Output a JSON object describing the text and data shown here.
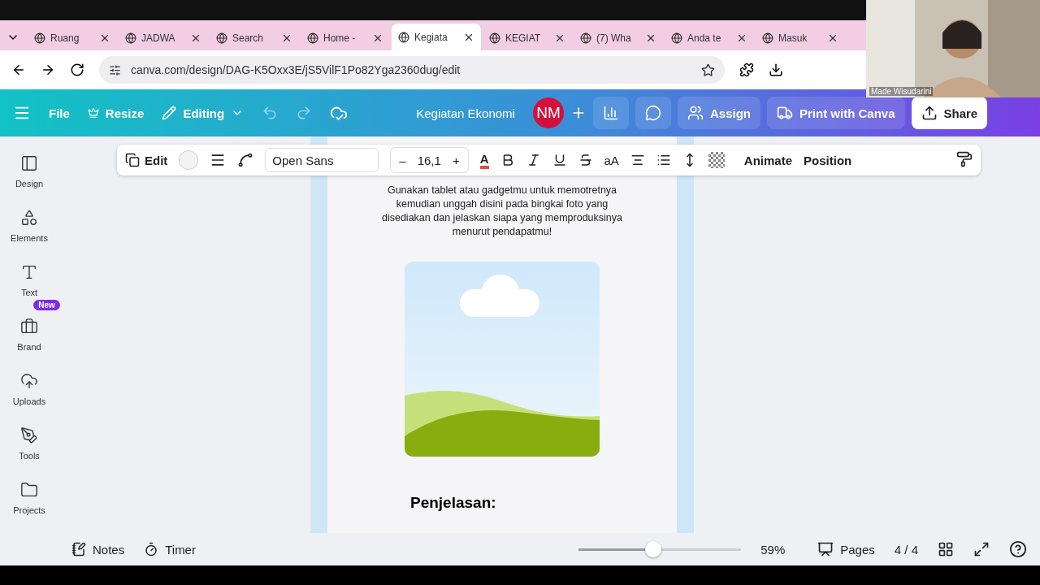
{
  "browser": {
    "tabs": [
      {
        "title": "Ruang",
        "selected": false
      },
      {
        "title": "JADWA",
        "selected": false
      },
      {
        "title": "Search",
        "selected": false
      },
      {
        "title": "Home -",
        "selected": false
      },
      {
        "title": "Kegiata",
        "selected": true
      },
      {
        "title": "KEGIAT",
        "selected": false
      },
      {
        "title": "(7) Wha",
        "selected": false
      },
      {
        "title": "Anda te",
        "selected": false
      },
      {
        "title": "Masuk",
        "selected": false
      }
    ],
    "url": "canva.com/design/DAG-K5Oxx3E/jS5VilF1Po82Yga2360dug/edit"
  },
  "video_overlay": {
    "kind": "picture",
    "name": "Made Wisudarini"
  },
  "header": {
    "menu": [
      "File",
      "Resize"
    ],
    "mode": "Editing",
    "design_title": "Kegiatan Ekonomi",
    "avatar": "NM",
    "buttons": [
      "Assign",
      "Print with Canva",
      "Share"
    ]
  },
  "toolbar": {
    "edit": "Edit",
    "font": "Open Sans",
    "minus": "–",
    "size": "16,1",
    "plus": "+",
    "text_color": "A",
    "text_buttons": [
      "aA"
    ],
    "animate": "Animate",
    "position": "Position"
  },
  "sidebar": {
    "items": [
      {
        "label": "Design"
      },
      {
        "label": "Elements"
      },
      {
        "label": "Text"
      },
      {
        "label": "Brand",
        "badge": "New"
      },
      {
        "label": "Uploads"
      },
      {
        "label": "Tools"
      },
      {
        "label": "Projects"
      }
    ]
  },
  "page": {
    "instruction_lines": [
      "Gunakan tablet atau gadgetmu untuk memotretnya",
      "kemudian unggah disini pada bingkai foto yang",
      "disediakan dan jelaskan siapa yang memproduksinya",
      "menurut pendapatmu!"
    ],
    "heading": "Penjelasan:"
  },
  "footer": {
    "notes": "Notes",
    "timer": "Timer",
    "zoom": {
      "level": 0.46,
      "reading": "59%"
    },
    "pages": "Pages",
    "page_count": "4 / 4"
  }
}
